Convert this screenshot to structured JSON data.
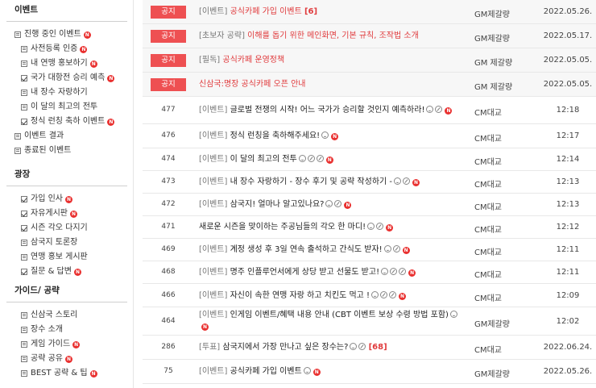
{
  "sidebar": {
    "sections": [
      {
        "title": "이벤트",
        "items": [
          {
            "label": "진행 중인 이벤트",
            "level": 1,
            "icon": "page-icon",
            "badge": true
          },
          {
            "label": "사전등록 인증",
            "level": 2,
            "icon": "page-icon",
            "badge": true
          },
          {
            "label": "내 연맹 홍보하기",
            "level": 2,
            "icon": "page-icon",
            "badge": true
          },
          {
            "label": "국가 대항전 승리 예측",
            "level": 2,
            "icon": "check-icon",
            "badge": true
          },
          {
            "label": "내 장수 자랑하기",
            "level": 2,
            "icon": "page-icon",
            "badge": false
          },
          {
            "label": "이 달의 최고의 전투",
            "level": 2,
            "icon": "page-icon",
            "badge": false
          },
          {
            "label": "정식 런칭 축하 이벤트",
            "level": 2,
            "icon": "check-icon",
            "badge": true
          },
          {
            "label": "이벤트 결과",
            "level": 1,
            "icon": "page-icon",
            "badge": false
          },
          {
            "label": "종료된 이벤트",
            "level": 1,
            "icon": "page-icon",
            "badge": false
          }
        ]
      },
      {
        "title": "광장",
        "items": [
          {
            "label": "가입 인사",
            "level": 2,
            "icon": "check-icon",
            "badge": true
          },
          {
            "label": "자유게시판",
            "level": 2,
            "icon": "check-icon",
            "badge": true
          },
          {
            "label": "시즌 각오 다지기",
            "level": 2,
            "icon": "check-icon",
            "badge": false
          },
          {
            "label": "삼국지 토론장",
            "level": 2,
            "icon": "page-icon",
            "badge": false
          },
          {
            "label": "연맹 홍보 게시판",
            "level": 2,
            "icon": "page-icon",
            "badge": false
          },
          {
            "label": "질문 & 답변",
            "level": 2,
            "icon": "check-icon",
            "badge": true
          }
        ]
      },
      {
        "title": "가이드/ 공략",
        "items": [
          {
            "label": "신삼국 스토리",
            "level": 2,
            "icon": "page-icon",
            "badge": false
          },
          {
            "label": "장수 소개",
            "level": 2,
            "icon": "page-icon",
            "badge": false
          },
          {
            "label": "게임 가이드",
            "level": 2,
            "icon": "page-icon",
            "badge": true
          },
          {
            "label": "공략 공유",
            "level": 2,
            "icon": "page-icon",
            "badge": true
          },
          {
            "label": "BEST 공략 & 팁",
            "level": 2,
            "icon": "page-icon",
            "badge": true
          }
        ]
      }
    ]
  },
  "posts": [
    {
      "num": "",
      "tag": "공지",
      "category": "[이벤트]",
      "title": "공식카페 가입 이벤트",
      "count": "[6]",
      "icons": [],
      "new": false,
      "red": true,
      "author": "GM제갈량",
      "date": "2022.05.26."
    },
    {
      "num": "",
      "tag": "공지",
      "category": "[초보자 공략]",
      "title": "이해를 돕기 위한 메인화면, 기본 규칙, 조작법 소개",
      "count": "",
      "icons": [],
      "new": false,
      "red": true,
      "author": "GM제갈량",
      "date": "2022.05.17."
    },
    {
      "num": "",
      "tag": "공지",
      "category": "[필독]",
      "title": "공식카페 운영정책",
      "count": "",
      "icons": [],
      "new": false,
      "red": true,
      "author": "GM 제갈량",
      "date": "2022.05.05."
    },
    {
      "num": "",
      "tag": "공지",
      "category": "",
      "title": "신삼국:명장 공식카페 오픈 안내",
      "count": "",
      "icons": [],
      "new": false,
      "red": true,
      "author": "GM 제갈량",
      "date": "2022.05.05."
    },
    {
      "num": "477",
      "tag": "",
      "category": "[이벤트]",
      "title": "글로벌 전쟁의 시작! 어느 국가가 승리할 것인지 예측하라!",
      "count": "",
      "icons": [
        "smile-icon",
        "pencil-icon"
      ],
      "new": true,
      "red": false,
      "author": "CM대교",
      "date": "12:18"
    },
    {
      "num": "476",
      "tag": "",
      "category": "[이벤트]",
      "title": "정식 런칭을 축하해주세요!",
      "count": "",
      "icons": [
        "smile-icon"
      ],
      "new": true,
      "red": false,
      "author": "CM대교",
      "date": "12:17"
    },
    {
      "num": "474",
      "tag": "",
      "category": "[이벤트]",
      "title": "이 달의 최고의 전투",
      "count": "",
      "icons": [
        "smile-icon",
        "pencil-icon",
        "pencil-icon"
      ],
      "new": true,
      "red": false,
      "author": "CM대교",
      "date": "12:14"
    },
    {
      "num": "473",
      "tag": "",
      "category": "[이벤트]",
      "title": "내 장수 자랑하기 - 장수 후기 및 공략 작성하기 -",
      "count": "",
      "icons": [
        "smile-icon",
        "pencil-icon"
      ],
      "new": true,
      "red": false,
      "author": "CM대교",
      "date": "12:13"
    },
    {
      "num": "472",
      "tag": "",
      "category": "[이벤트]",
      "title": "삼국지! 얼마나 알고있나요?",
      "count": "",
      "icons": [
        "smile-icon",
        "pencil-icon"
      ],
      "new": true,
      "red": false,
      "author": "CM대교",
      "date": "12:13"
    },
    {
      "num": "471",
      "tag": "",
      "category": "",
      "title": "새로운 시즌을 맞이하는 주공님들의 각오 한 마디!",
      "count": "",
      "icons": [
        "smile-icon",
        "pencil-icon"
      ],
      "new": true,
      "red": false,
      "author": "CM대교",
      "date": "12:12"
    },
    {
      "num": "469",
      "tag": "",
      "category": "[이벤트]",
      "title": "계정 생성 후 3일 연속 출석하고 간식도 받자!",
      "count": "",
      "icons": [
        "smile-icon",
        "pencil-icon"
      ],
      "new": true,
      "red": false,
      "author": "CM대교",
      "date": "12:11"
    },
    {
      "num": "468",
      "tag": "",
      "category": "[이벤트]",
      "title": "명주 인플루언서에게 상당 받고 선물도 받고!",
      "count": "",
      "icons": [
        "smile-icon",
        "pencil-icon",
        "pencil-icon"
      ],
      "new": true,
      "red": false,
      "author": "CM대교",
      "date": "12:11"
    },
    {
      "num": "466",
      "tag": "",
      "category": "[이벤트]",
      "title": "자신이 속한 연맹 자랑 하고 치킨도 먹고 !",
      "count": "",
      "icons": [
        "smile-icon",
        "pencil-icon",
        "pencil-icon"
      ],
      "new": true,
      "red": false,
      "author": "CM대교",
      "date": "12:09"
    },
    {
      "num": "464",
      "tag": "",
      "category": "[이벤트]",
      "title": "인게임 이벤트/혜택 내용 안내 (CBT 이벤트 보상 수령 방법 포함)",
      "count": "",
      "icons": [
        "smile-icon"
      ],
      "new": true,
      "red": false,
      "author": "GM제갈량",
      "date": "12:02"
    },
    {
      "num": "286",
      "tag": "",
      "category": "[투표]",
      "title": "삼국지에서 가장 만나고 싶은 장수는?",
      "count": "[68]",
      "icons": [
        "smile-icon",
        "pencil-icon"
      ],
      "new": false,
      "red": false,
      "author": "CM대교",
      "date": "2022.06.24."
    },
    {
      "num": "75",
      "tag": "",
      "category": "[이벤트]",
      "title": "공식카페 가입 이벤트",
      "count": "",
      "icons": [
        "smile-icon"
      ],
      "new": true,
      "red": false,
      "author": "GM제갈량",
      "date": "2022.05.26."
    }
  ],
  "labels": {
    "new_badge": "N"
  }
}
